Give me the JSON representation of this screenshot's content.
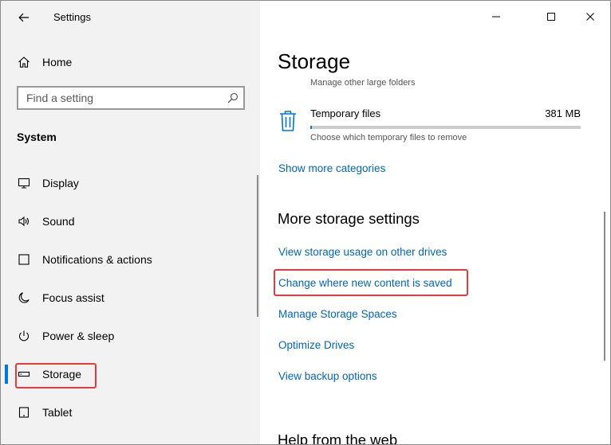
{
  "window": {
    "title": "Settings",
    "minimize_icon": "minimize-icon",
    "maximize_icon": "maximize-icon",
    "close_icon": "close-icon"
  },
  "sidebar": {
    "back_icon": "back-arrow-icon",
    "home": {
      "label": "Home",
      "icon": "home-icon"
    },
    "search": {
      "placeholder": "Find a setting",
      "value": "",
      "icon": "search-icon"
    },
    "section": "System",
    "items": [
      {
        "label": "Display",
        "icon": "display-icon",
        "active": false
      },
      {
        "label": "Sound",
        "icon": "speaker-icon",
        "active": false
      },
      {
        "label": "Notifications & actions",
        "icon": "notification-icon",
        "active": false
      },
      {
        "label": "Focus assist",
        "icon": "moon-icon",
        "active": false
      },
      {
        "label": "Power & sleep",
        "icon": "power-icon",
        "active": false
      },
      {
        "label": "Storage",
        "icon": "drive-icon",
        "active": true
      },
      {
        "label": "Tablet",
        "icon": "tablet-icon",
        "active": false
      }
    ]
  },
  "main": {
    "title": "Storage",
    "partial_text": "Manage other large folders",
    "temp_files": {
      "label": "Temporary files",
      "size": "381 MB",
      "description": "Choose which temporary files to remove",
      "usage_fraction": 0.005,
      "icon": "trash-icon"
    },
    "show_more": "Show more categories",
    "more_settings": {
      "heading": "More storage settings",
      "links": [
        "View storage usage on other drives",
        "Change where new content is saved",
        "Manage Storage Spaces",
        "Optimize Drives",
        "View backup options"
      ]
    },
    "help_heading": "Help from the web"
  },
  "colors": {
    "accent": "#0078d7",
    "link": "#0067b8",
    "highlight": "#e23c3c",
    "sidebar_bg": "#f2f2f2"
  }
}
